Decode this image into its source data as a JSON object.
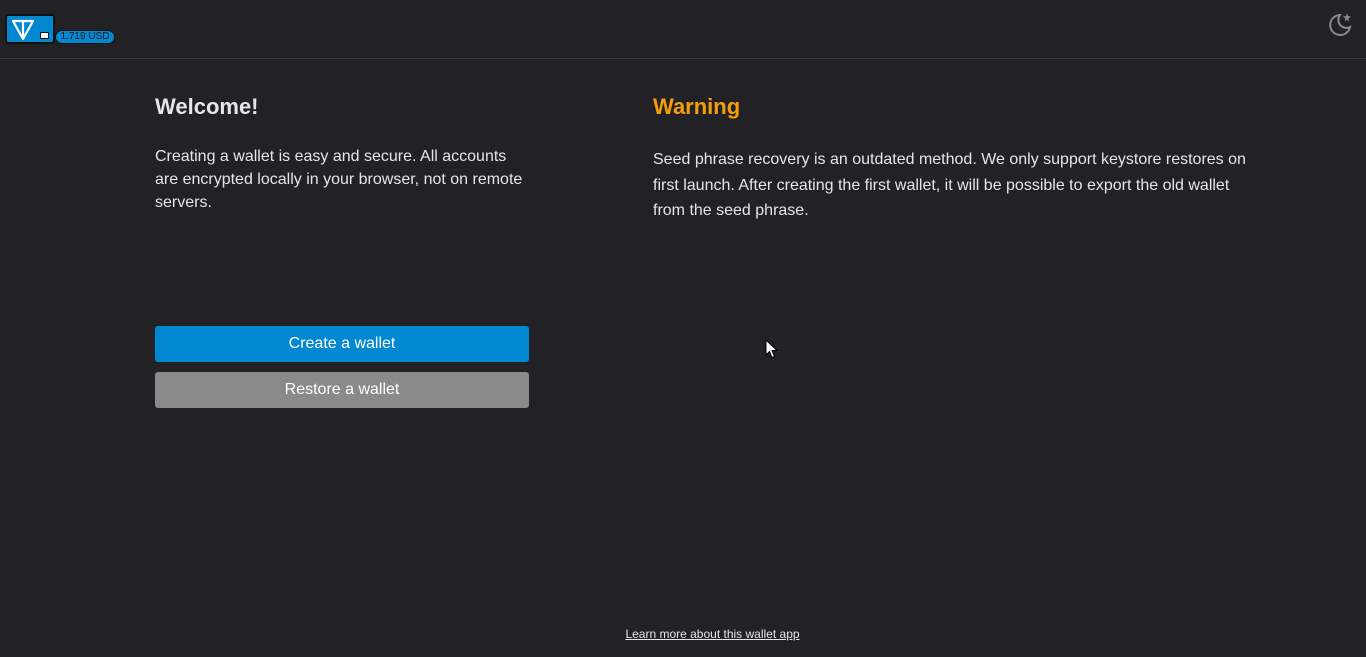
{
  "header": {
    "logo_icon": "ton-diamond-icon",
    "price_badge": "1.719 USD",
    "theme_toggle_icon": "moon-star-icon"
  },
  "welcome": {
    "title": "Welcome!",
    "text": "Creating a wallet is easy and secure. All accounts are encrypted locally in your browser, not on remote servers."
  },
  "warning": {
    "title": "Warning",
    "text": "Seed phrase recovery is an outdated method. We only support keystore restores on first launch. After creating the first wallet, it will be possible to export the old wallet from the seed phrase."
  },
  "actions": {
    "create_label": "Create a wallet",
    "restore_label": "Restore a wallet"
  },
  "footer": {
    "learn_more": "Learn more about this wallet app"
  },
  "colors": {
    "background": "#222226",
    "accent": "#0288d1",
    "warning": "#f59e0b",
    "secondary_button": "#8a8a8a"
  }
}
